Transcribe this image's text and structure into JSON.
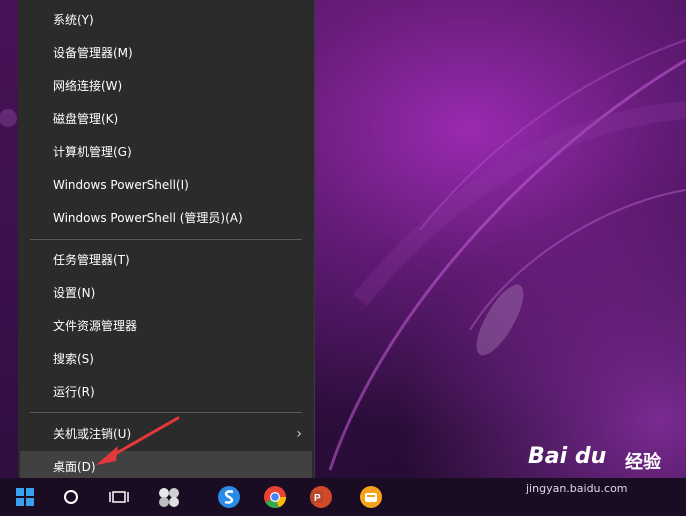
{
  "menu": {
    "items": [
      {
        "label": "系统(Y)"
      },
      {
        "label": "设备管理器(M)"
      },
      {
        "label": "网络连接(W)"
      },
      {
        "label": "磁盘管理(K)"
      },
      {
        "label": "计算机管理(G)"
      },
      {
        "label": "Windows PowerShell(I)"
      },
      {
        "label": "Windows PowerShell (管理员)(A)"
      },
      {
        "label": "任务管理器(T)"
      },
      {
        "label": "设置(N)"
      },
      {
        "label": "文件资源管理器"
      },
      {
        "label": "搜索(S)"
      },
      {
        "label": "运行(R)"
      },
      {
        "label": "关机或注销(U)"
      },
      {
        "label": "桌面(D)"
      }
    ],
    "selected_item": "桌面(D)",
    "submenu_chevron": "›"
  },
  "taskbar": {
    "icons": [
      "windows-start-icon",
      "cortana-icon",
      "task-view-icon",
      "app-icon",
      "sogou-icon",
      "chrome-icon",
      "powerpoint-icon",
      "app-orange-icon"
    ],
    "powerpoint_letter": "P"
  },
  "watermark": {
    "brand": "Bai du",
    "jingyan": "经验",
    "url": "jingyan.baidu.com"
  },
  "colors": {
    "menu_bg": "#2b2b2b",
    "highlight": "#414141",
    "arrow": "#e5383b",
    "desktop_accent": "#9a2ab0"
  }
}
